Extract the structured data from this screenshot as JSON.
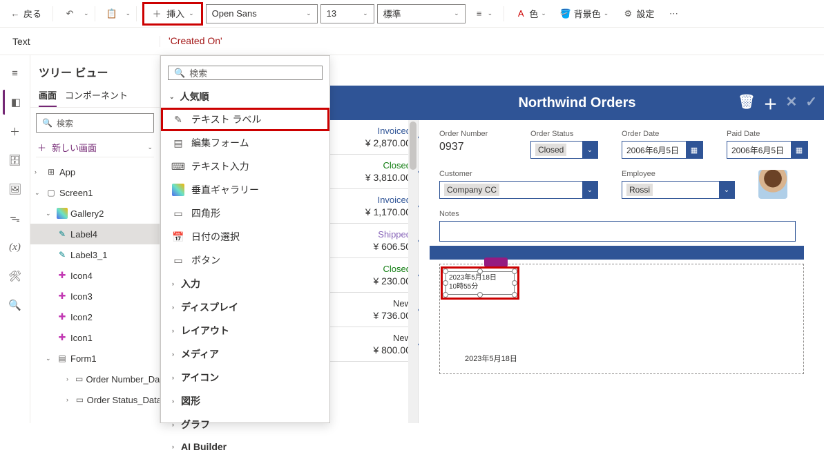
{
  "toolbar": {
    "back": "戻る",
    "insert": "挿入",
    "font": "Open Sans",
    "size": "13",
    "weight": "標準",
    "fill": "色",
    "bgfill": "背景色",
    "settings": "設定"
  },
  "formula": {
    "property": "Text",
    "value": "'Created On'"
  },
  "tree": {
    "title": "ツリー ビュー",
    "tabs": {
      "screens": "画面",
      "components": "コンポーネント"
    },
    "search_ph": "検索",
    "new_screen": "新しい画面",
    "items": {
      "app": "App",
      "screen1": "Screen1",
      "gallery2": "Gallery2",
      "label4": "Label4",
      "label3_1": "Label3_1",
      "icon4": "Icon4",
      "icon3": "Icon3",
      "icon2": "Icon2",
      "icon1": "Icon1",
      "form1": "Form1",
      "card_ordernum": "Order Number_DataCard",
      "card_orderstatus": "Order Status_DataCard"
    }
  },
  "insert_panel": {
    "search_ph": "検索",
    "popular": "人気順",
    "text_label": "テキスト ラベル",
    "edit_form": "編集フォーム",
    "text_input": "テキスト入力",
    "vgallery": "垂直ギャラリー",
    "rectangle": "四角形",
    "date_picker": "日付の選択",
    "button": "ボタン",
    "cat_input": "入力",
    "cat_display": "ディスプレイ",
    "cat_layout": "レイアウト",
    "cat_media": "メディア",
    "cat_icons": "アイコン",
    "cat_shapes": "図形",
    "cat_charts": "グラフ",
    "cat_ai": "AI Builder"
  },
  "orders": {
    "title": "Northwind Orders",
    "list": [
      {
        "status": "Invoiced",
        "cls": "st-invoiced",
        "amount": "¥ 2,870.00"
      },
      {
        "status": "Closed",
        "cls": "st-closed",
        "amount": "¥ 3,810.00"
      },
      {
        "status": "Invoiced",
        "cls": "st-invoiced",
        "amount": "¥ 1,170.00"
      },
      {
        "status": "Shipped",
        "cls": "st-shipped",
        "amount": "¥ 606.50"
      },
      {
        "status": "Closed",
        "cls": "st-closed",
        "amount": "¥ 230.00"
      },
      {
        "status": "New",
        "cls": "st-new",
        "amount": "¥ 736.00"
      },
      {
        "status": "New",
        "cls": "st-new",
        "amount": "¥ 800.00"
      }
    ],
    "fields": {
      "order_number_lab": "Order Number",
      "order_number": "0937",
      "order_status_lab": "Order Status",
      "order_status": "Closed",
      "order_date_lab": "Order Date",
      "order_date": "2006年6月5日",
      "paid_date_lab": "Paid Date",
      "paid_date": "2006年6月5日",
      "customer_lab": "Customer",
      "customer": "Company CC",
      "employee_lab": "Employee",
      "employee": "Rossi",
      "notes_lab": "Notes"
    },
    "label4_text_l1": "2023年5月18日",
    "label4_text_l2": "10時55分",
    "footer_ts": "2023年5月18日"
  }
}
